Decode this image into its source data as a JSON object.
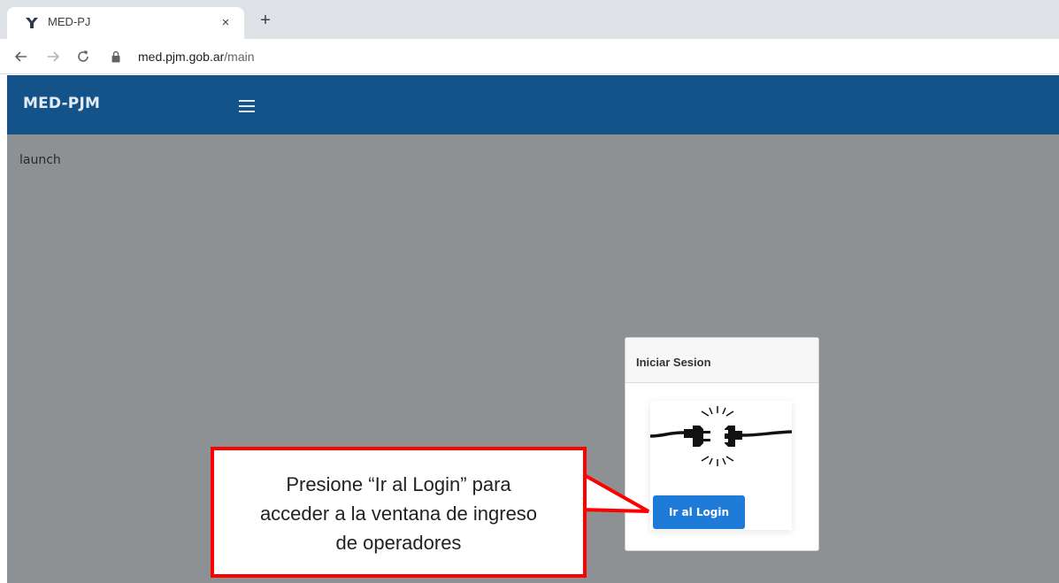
{
  "browser": {
    "tab_title": "MED-PJ",
    "close_label": "×",
    "new_tab_label": "+",
    "url_host": "med.pjm.gob.ar",
    "url_path": "/main"
  },
  "app": {
    "brand": "MED-PJM",
    "launch_text": "launch"
  },
  "login_card": {
    "title": "Iniciar Sesion",
    "button_label": "Ir al Login"
  },
  "callout": {
    "line1": "Presione “Ir al Login” para",
    "line2": "acceder a la ventana de ingreso",
    "line3": "de operadores"
  },
  "colors": {
    "appbar": "#13538a",
    "page_overlay": "#8e9193",
    "button": "#1e7bd8",
    "callout_border": "#ff0000"
  }
}
